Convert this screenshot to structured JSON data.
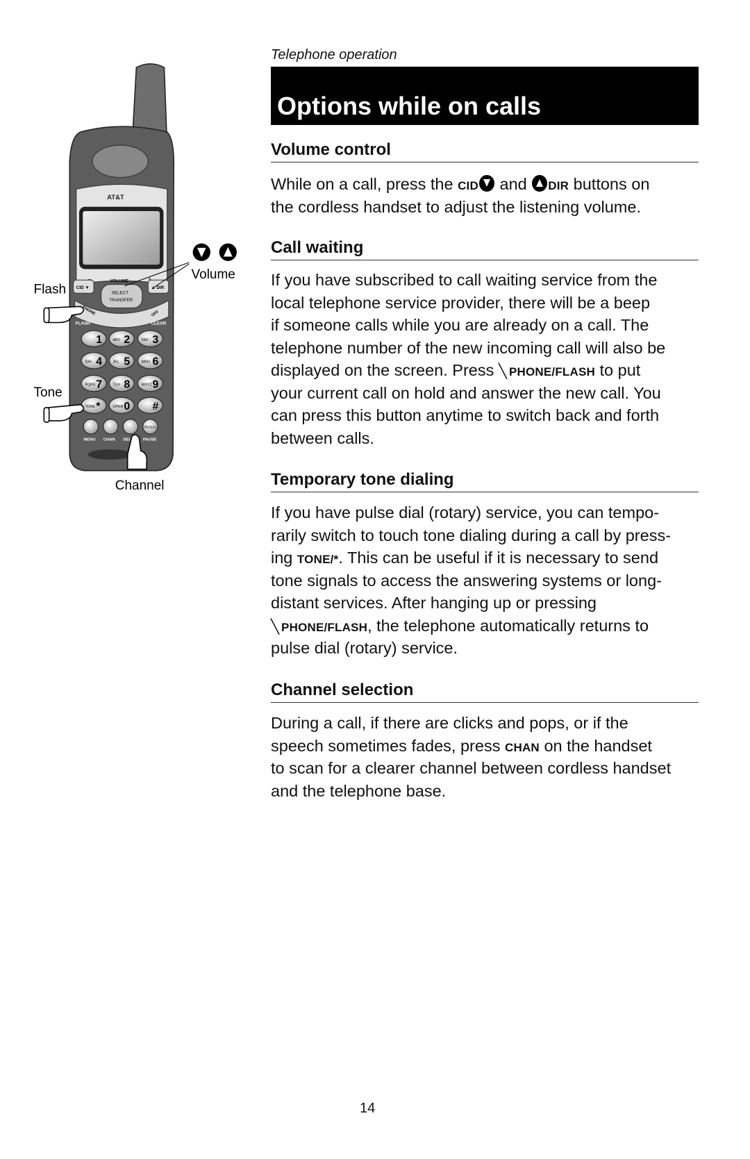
{
  "header": {
    "kicker": "Telephone operation",
    "title": "Options while on calls"
  },
  "illustration": {
    "callouts": {
      "flash": "Flash",
      "tone": "Tone",
      "channel": "Channel",
      "volume": "Volume"
    },
    "handset_labels": {
      "brand": "AT&T",
      "volume": "VOLUME",
      "minus": "–",
      "plus": "+",
      "select": "SELECT",
      "transfer": "TRANSFER",
      "cid": "CID ▼",
      "dir": "▲ DIR",
      "flash": "FLASH",
      "clear": "CLEAR",
      "phone": "PHONE",
      "off": "OFF",
      "keys": [
        {
          "sub": "",
          "main": "1"
        },
        {
          "sub": "ABC",
          "main": "2"
        },
        {
          "sub": "DEF",
          "main": "3"
        },
        {
          "sub": "GHI",
          "main": "4"
        },
        {
          "sub": "JKL",
          "main": "5"
        },
        {
          "sub": "MNO",
          "main": "6"
        },
        {
          "sub": "PQRS",
          "main": "7"
        },
        {
          "sub": "TUV",
          "main": "8"
        },
        {
          "sub": "WXYZ",
          "main": "9"
        },
        {
          "sub": "TONE",
          "main": "*"
        },
        {
          "sub": "OPER",
          "main": "0"
        },
        {
          "sub": "",
          "main": "#"
        }
      ],
      "bottom": [
        "MENU",
        "CHAN",
        "DELETE",
        "PAUSE"
      ],
      "redial": "REDIAL"
    }
  },
  "sections": [
    {
      "heading": "Volume control",
      "lines": [
        [
          {
            "t": "While on a call, press the "
          },
          {
            "k": "CID"
          },
          {
            "i": "down-arrow"
          },
          {
            "t": " and "
          },
          {
            "i": "up-arrow"
          },
          {
            "k": "DIR"
          },
          {
            "t": " buttons on"
          }
        ],
        [
          {
            "t": "the cordless handset to adjust the listening volume."
          }
        ]
      ]
    },
    {
      "heading": "Call waiting",
      "lines": [
        [
          {
            "t": "If you have subscribed to call waiting service from the"
          }
        ],
        [
          {
            "t": "local telephone service provider, there will be a beep"
          }
        ],
        [
          {
            "t": "if someone calls while you are already on a call. The"
          }
        ],
        [
          {
            "t": "telephone number of the new incoming call will also be"
          }
        ],
        [
          {
            "t": "displayed on the screen. Press "
          },
          {
            "i": "handset"
          },
          {
            "k": "PHONE/FLASH"
          },
          {
            "t": " to put"
          }
        ],
        [
          {
            "t": "your current call on hold and answer the new call. You"
          }
        ],
        [
          {
            "t": "can press this button anytime to switch back and forth"
          }
        ],
        [
          {
            "t": "between calls."
          }
        ]
      ]
    },
    {
      "heading": "Temporary tone dialing",
      "lines": [
        [
          {
            "t": "If you have pulse dial (rotary) service, you can tempo-"
          }
        ],
        [
          {
            "t": "rarily switch to touch tone dialing during a call by press-"
          }
        ],
        [
          {
            "t": "ing "
          },
          {
            "k": "TONE/*"
          },
          {
            "t": ". This can be useful if it is necessary to send"
          }
        ],
        [
          {
            "t": "tone signals to access the answering systems or long-"
          }
        ],
        [
          {
            "t": "distant services. After hanging up or pressing"
          }
        ],
        [
          {
            "i": "handset"
          },
          {
            "k": "PHONE/FLASH"
          },
          {
            "t": ", the telephone automatically returns to"
          }
        ],
        [
          {
            "t": "pulse dial (rotary) service."
          }
        ]
      ]
    },
    {
      "heading": "Channel selection",
      "lines": [
        [
          {
            "t": "During a call, if there are clicks and pops, or if the"
          }
        ],
        [
          {
            "t": "speech sometimes fades, press "
          },
          {
            "k": "CHAN"
          },
          {
            "t": " on the handset"
          }
        ],
        [
          {
            "t": "to scan for a clearer channel between cordless handset"
          }
        ],
        [
          {
            "t": "and the telephone base."
          }
        ]
      ]
    }
  ],
  "footer": {
    "page_number": "14"
  }
}
